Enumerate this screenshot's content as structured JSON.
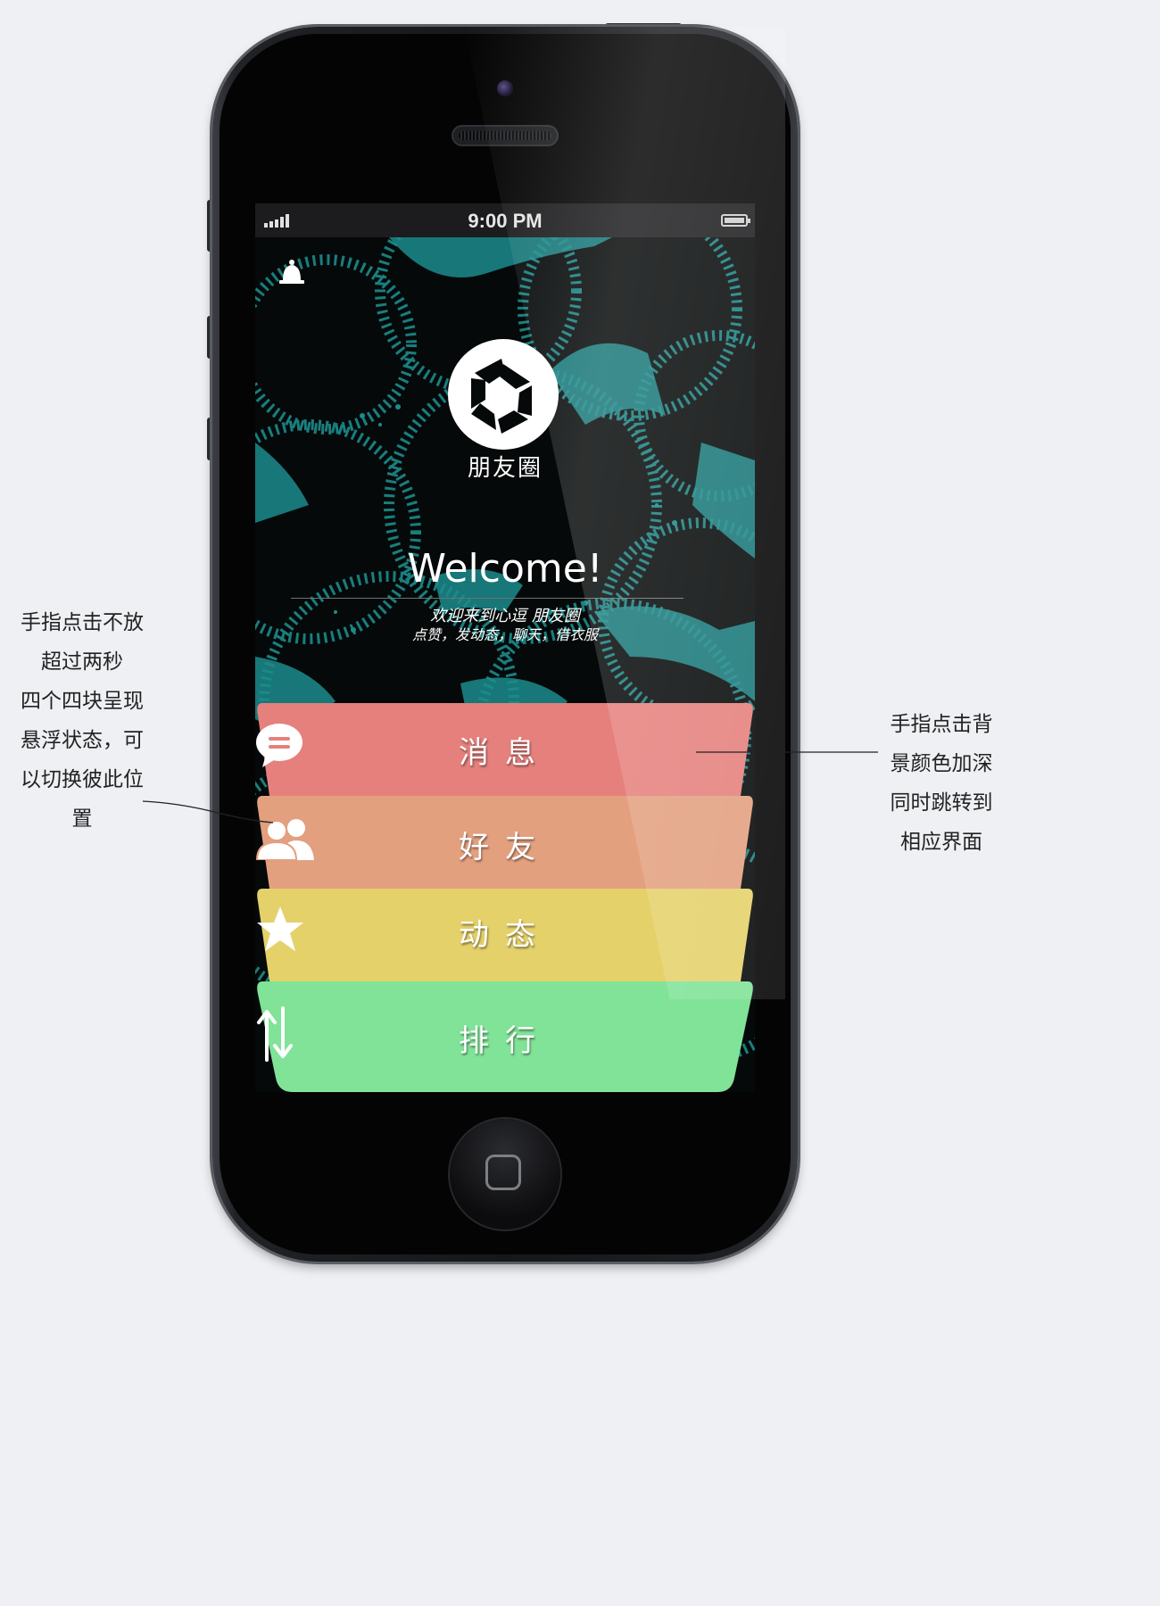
{
  "annotations": {
    "left_lines": [
      "手指点击不放",
      "超过两秒",
      "四个四块呈现",
      "悬浮状态，可",
      "以切换彼此位",
      "置"
    ],
    "right_lines": [
      "手指点击背",
      "景颜色加深",
      "同时跳转到",
      "相应界面"
    ]
  },
  "statusbar": {
    "time": "9:00 PM",
    "signal_icon": "signal-bars-icon",
    "battery_icon": "battery-icon"
  },
  "header": {
    "notification_icon": "bell-icon",
    "logo_icon": "camera-aperture-icon",
    "brand": "朋友圈"
  },
  "welcome": {
    "title": "Welcome!",
    "line1": "欢迎来到心逗 朋友圈",
    "line2": "点赞，发动态，聊天，借衣服"
  },
  "menu": [
    {
      "label": "消息",
      "icon": "chat-bubble-icon",
      "color": "#e5807c"
    },
    {
      "label": "好友",
      "icon": "friends-icon",
      "color": "#e3a07f"
    },
    {
      "label": "动态",
      "icon": "star-icon",
      "color": "#e5d16a"
    },
    {
      "label": "排行",
      "icon": "sort-arrows-icon",
      "color": "#80e397"
    }
  ],
  "colors": {
    "background": "#eef0f3",
    "screen_pattern": "#1c8b8c",
    "statusbar": "#1c1c1e"
  }
}
